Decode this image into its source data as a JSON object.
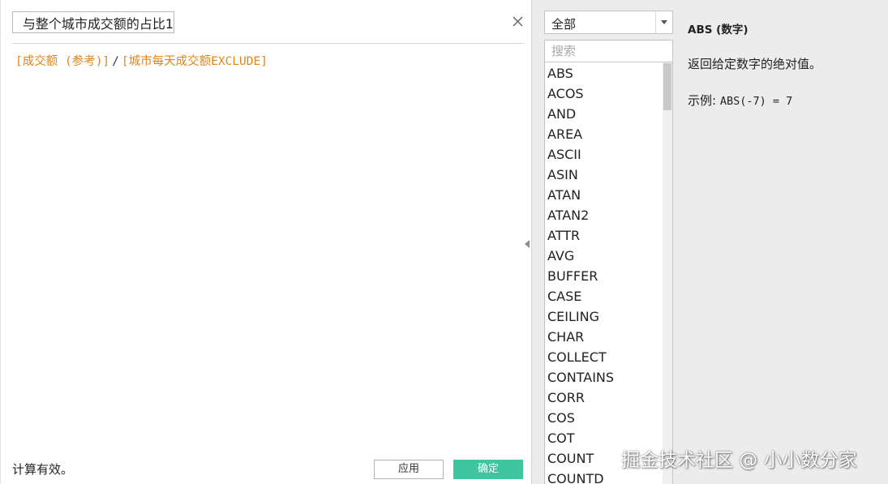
{
  "editor": {
    "calc_name": "与整个城市成交额的占比1",
    "formula": {
      "field_1": "[成交额 (参考)]",
      "operator": "/",
      "field_2": "[城市每天成交额EXCLUDE]"
    },
    "status": "计算有效。",
    "apply_label": "应用",
    "ok_label": "确定"
  },
  "functions": {
    "category_selected": "全部",
    "search_placeholder": "搜索",
    "items": [
      "ABS",
      "ACOS",
      "AND",
      "AREA",
      "ASCII",
      "ASIN",
      "ATAN",
      "ATAN2",
      "ATTR",
      "AVG",
      "BUFFER",
      "CASE",
      "CEILING",
      "CHAR",
      "COLLECT",
      "CONTAINS",
      "CORR",
      "COS",
      "COT",
      "COUNT",
      "COUNTD"
    ]
  },
  "help": {
    "title": "ABS (数字)",
    "description": "返回给定数字的绝对值。",
    "example_label": "示例:",
    "example_code": "ABS(-7) = 7"
  },
  "watermark": "掘金技术社区 @ 小小数分家",
  "colors": {
    "field_color": "#e2861b",
    "ok_button": "#3fc5a0",
    "panel_bg": "#ececec"
  }
}
